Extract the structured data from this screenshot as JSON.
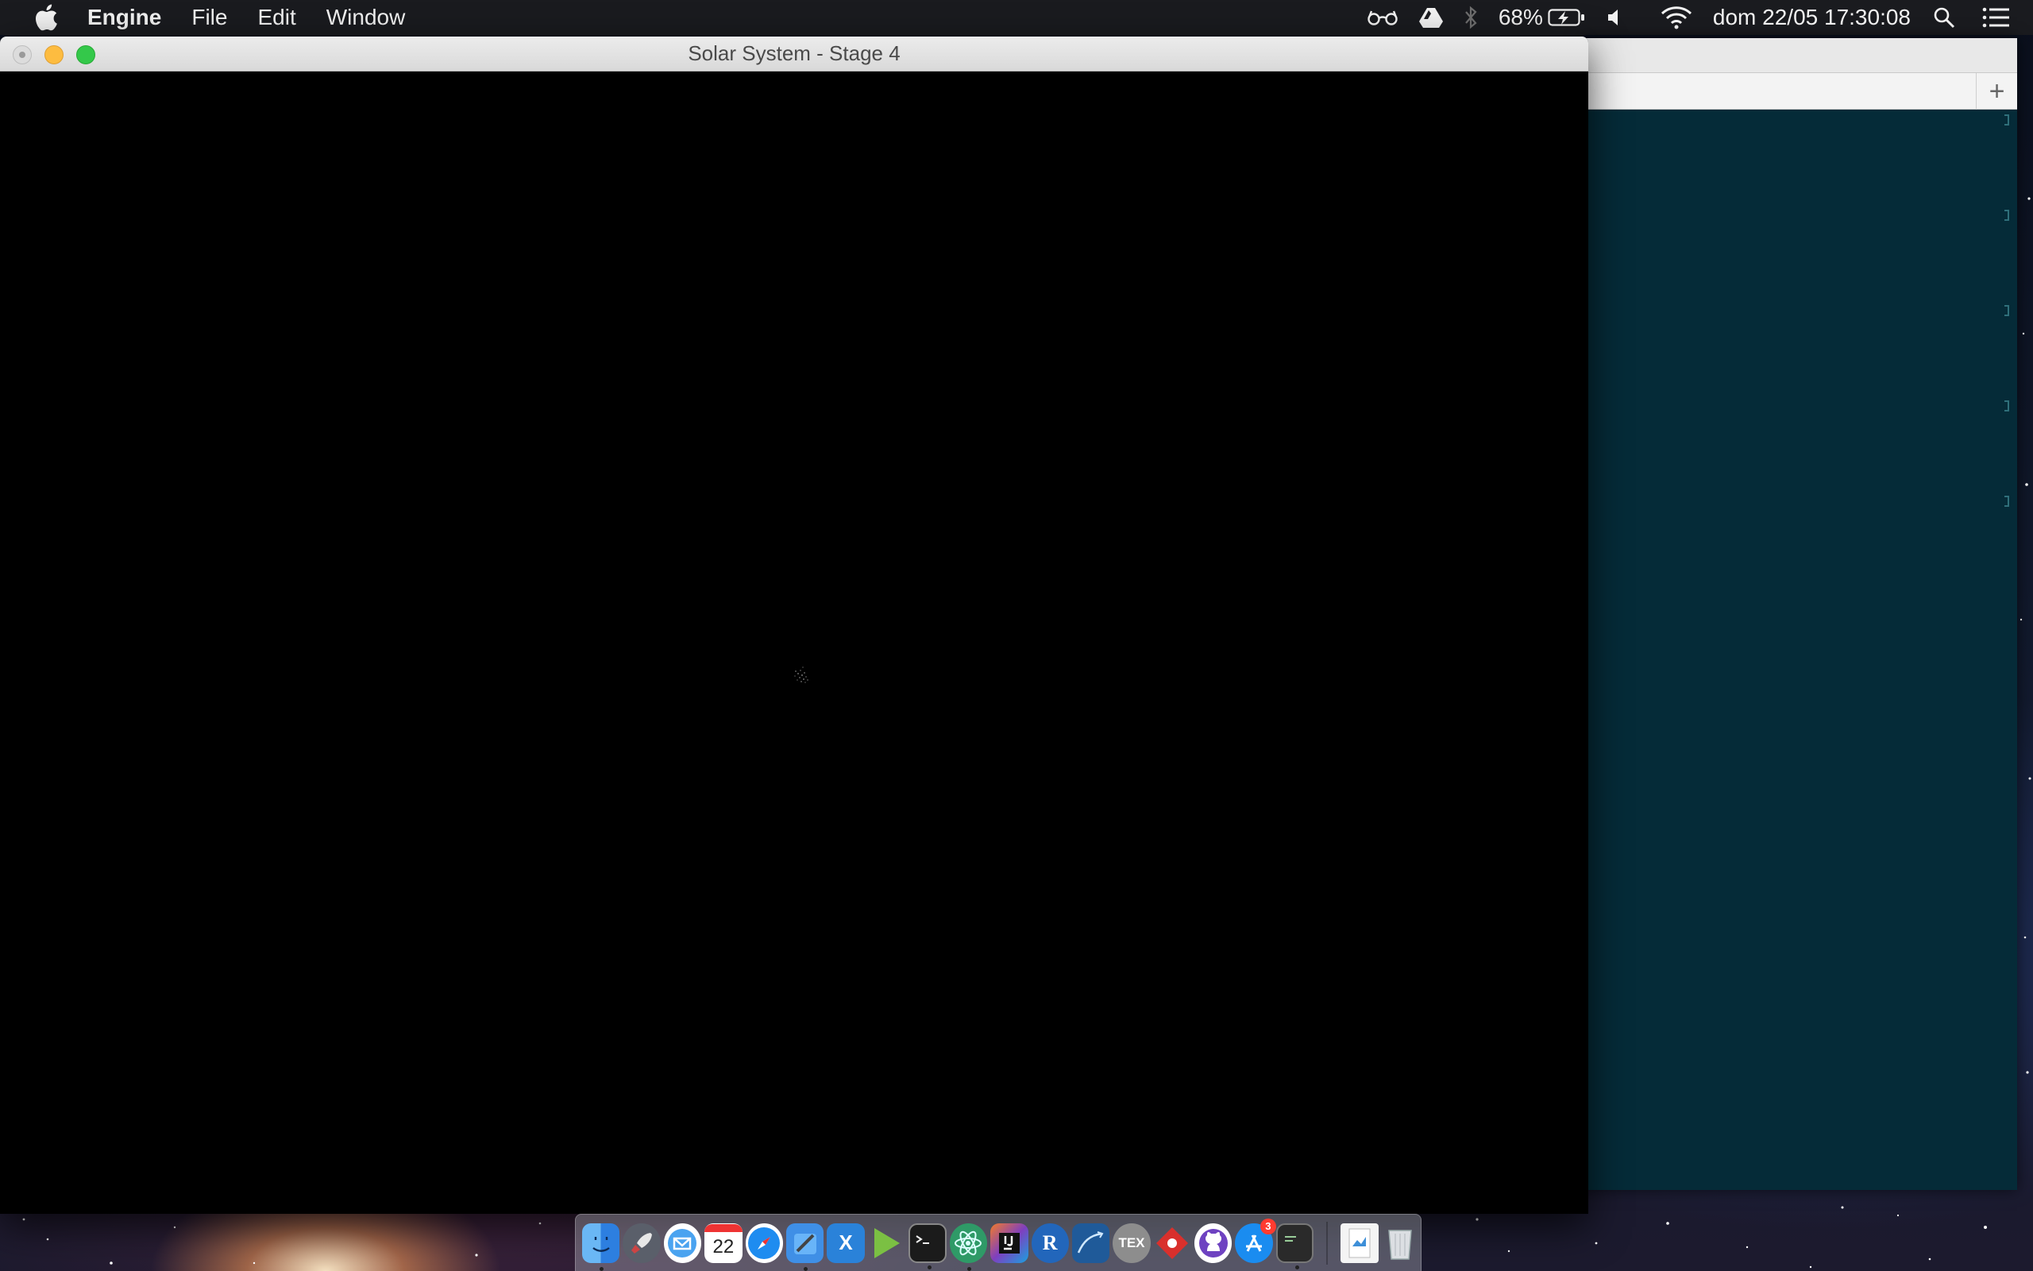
{
  "menubar": {
    "app_name": "Engine",
    "menus": [
      "File",
      "Edit",
      "Window"
    ],
    "battery_percent": "68%",
    "datetime": "dom 22/05  17:30:08"
  },
  "window": {
    "title": "Solar System - Stage 4"
  },
  "background_window": {
    "new_tab_label": "+"
  },
  "dock": {
    "calendar_day": "22",
    "r_label": "R",
    "tex_label": "TEX",
    "xcode_label": "X",
    "appstore_badge": "3"
  },
  "colors": {
    "viewport_bg": "#000000",
    "bg_window_content": "#052b38",
    "traffic_minimize": "#fdbc40",
    "traffic_zoom": "#34c84a"
  }
}
